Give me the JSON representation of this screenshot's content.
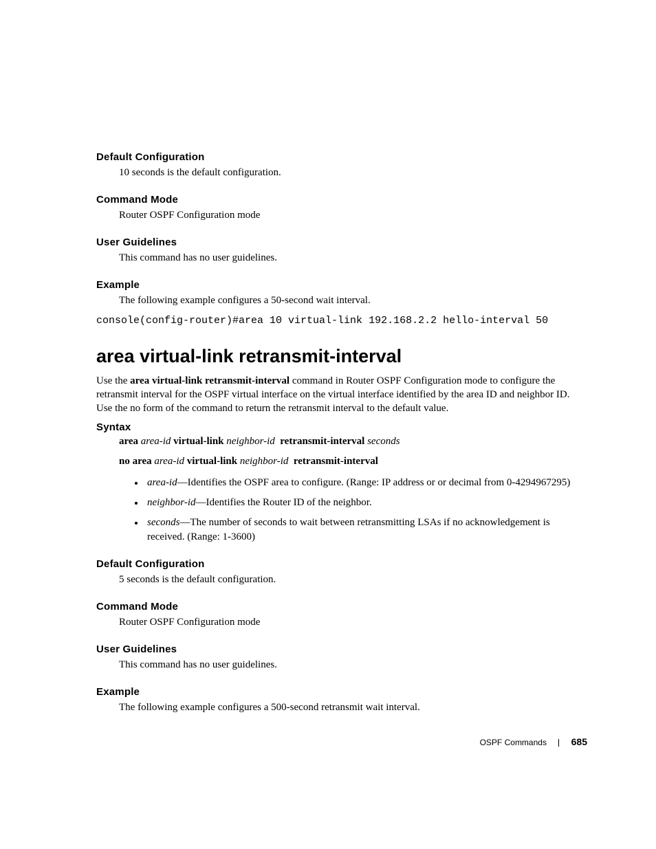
{
  "prev": {
    "defaultConfig": {
      "heading": "Default Configuration",
      "body": "10 seconds is the default configuration."
    },
    "commandMode": {
      "heading": "Command Mode",
      "body": "Router OSPF Configuration mode"
    },
    "userGuidelines": {
      "heading": "User Guidelines",
      "body": "This command has no user guidelines."
    },
    "example": {
      "heading": "Example",
      "body": "The following example configures a 50-second wait interval."
    },
    "code": "console(config-router)#area 10 virtual-link 192.168.2.2 hello-interval 50"
  },
  "cmd": {
    "title": "area virtual-link retransmit-interval",
    "intro_pre": "Use the ",
    "intro_bold": "area virtual-link retransmit-interval",
    "intro_post": " command in Router OSPF Configuration mode to configure the retransmit interval for the OSPF virtual interface on the virtual interface identified by the area ID and neighbor ID. Use the no form of the command to return the retransmit interval to the default value.",
    "syntax": {
      "heading": "Syntax",
      "line1": {
        "kw1": "area",
        "p1": "area-id",
        "kw2": "virtual-link",
        "p2": "neighbor-id",
        "kw3": "retransmit-interval",
        "p3": "seconds"
      },
      "line2": {
        "kw1": "no area",
        "p1": "area-id",
        "kw2": "virtual-link",
        "p2": "neighbor-id",
        "kw3": "retransmit-interval"
      },
      "params": [
        {
          "name": "area-id",
          "desc": "—Identifies the OSPF area to configure. (Range: IP address or or decimal from 0-4294967295)"
        },
        {
          "name": "neighbor-id",
          "desc": "—Identifies the Router ID of the neighbor."
        },
        {
          "name": "seconds",
          "desc": "—The number of seconds to wait between retransmitting LSAs if no acknowledgement is received. (Range: 1-3600)"
        }
      ]
    },
    "defaultConfig": {
      "heading": "Default Configuration",
      "body": "5 seconds is the default configuration."
    },
    "commandMode": {
      "heading": "Command Mode",
      "body": "Router OSPF Configuration mode"
    },
    "userGuidelines": {
      "heading": "User Guidelines",
      "body": "This command has no user guidelines."
    },
    "example": {
      "heading": "Example",
      "body": "The following example configures a 500-second retransmit wait interval."
    }
  },
  "footer": {
    "section": "OSPF Commands",
    "page": "685"
  }
}
